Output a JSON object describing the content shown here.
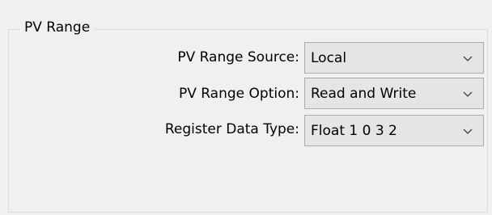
{
  "group": {
    "title": "PV Range"
  },
  "fields": [
    {
      "label": "PV Range Source:",
      "value": "Local",
      "icon": "chevron-down-icon"
    },
    {
      "label": "PV Range Option:",
      "value": "Read and Write",
      "icon": "chevron-down-icon"
    },
    {
      "label": "Register Data Type:",
      "value": "Float 1 0 3 2",
      "icon": "chevron-down-icon"
    }
  ],
  "colors": {
    "background": "#f0f0f0",
    "combo_fill": "#e5e5e5",
    "combo_border": "#adadad",
    "group_border": "#dcdcdc"
  }
}
